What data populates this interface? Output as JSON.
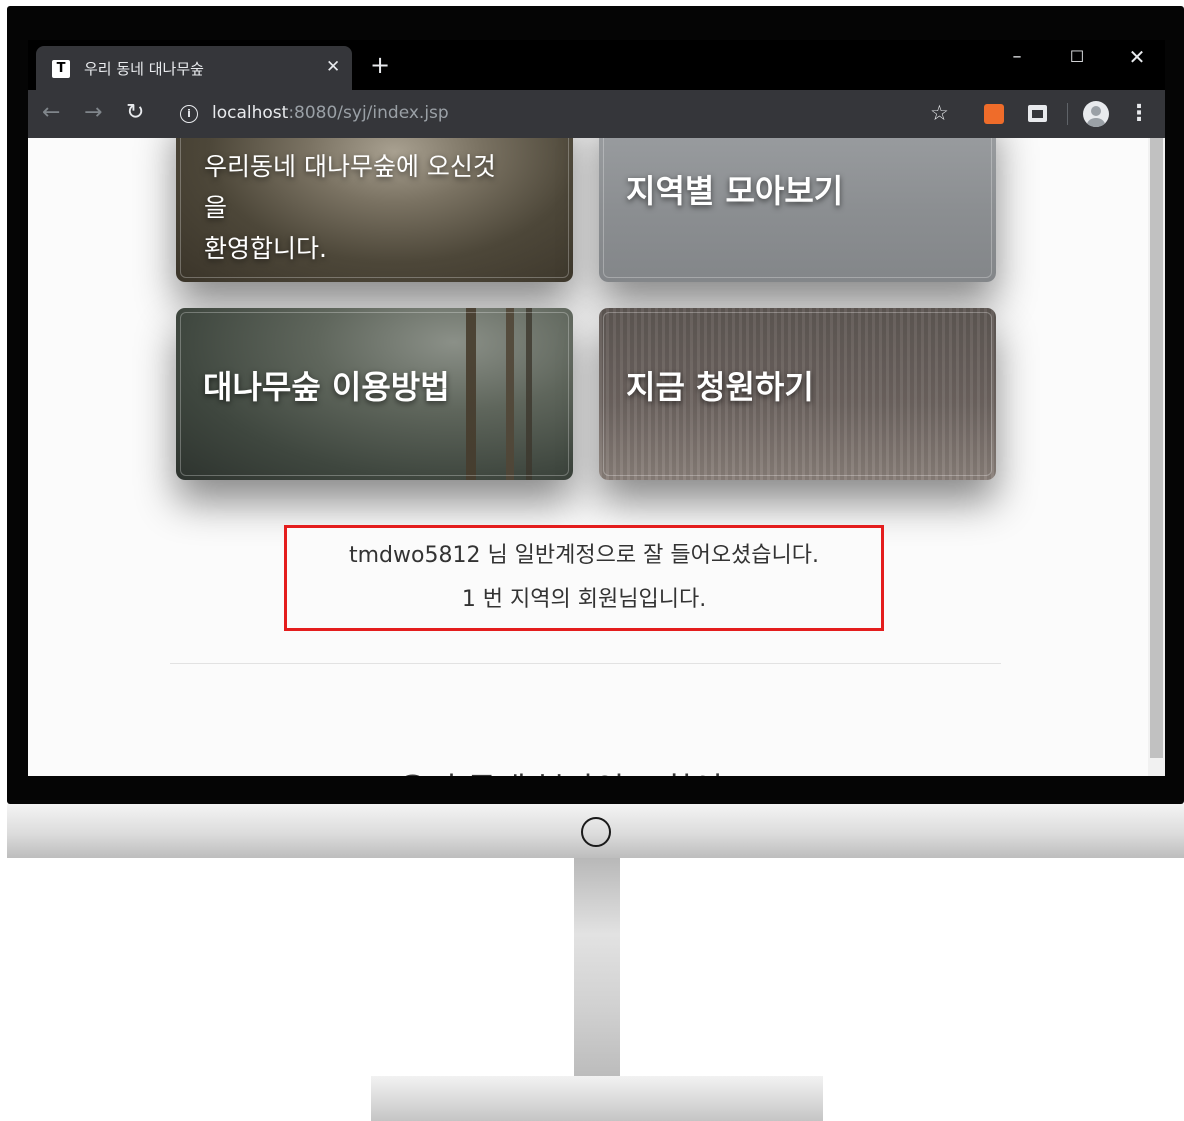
{
  "browser": {
    "tab_title": "우리 동네 대나무숲",
    "favicon_letter": "T",
    "url_host": "localhost",
    "url_rest": ":8080/syj/index.jsp"
  },
  "cards": {
    "welcome_lines": [
      "우리동네 대나무숲에 오신것",
      "을",
      "환영합니다."
    ],
    "region": "지역별 모아보기",
    "howto": "대나무숲 이용방법",
    "petition": "지금 청원하기"
  },
  "notice": {
    "line1": "tmdwo5812 님 일반계정으로 잘 들어오셨습니다.",
    "line2": "1 번 지역의 회원님입니다."
  },
  "footer": {
    "title": "우리 동네 블라인드 참여"
  },
  "icons": {
    "back": "arrow-left-icon",
    "forward": "arrow-right-icon",
    "reload": "reload-icon",
    "info": "info-icon",
    "star": "star-icon",
    "menu": "more-vertical-icon"
  },
  "colors": {
    "notice_border": "#e41d1d",
    "browser_chrome": "#35363a"
  }
}
